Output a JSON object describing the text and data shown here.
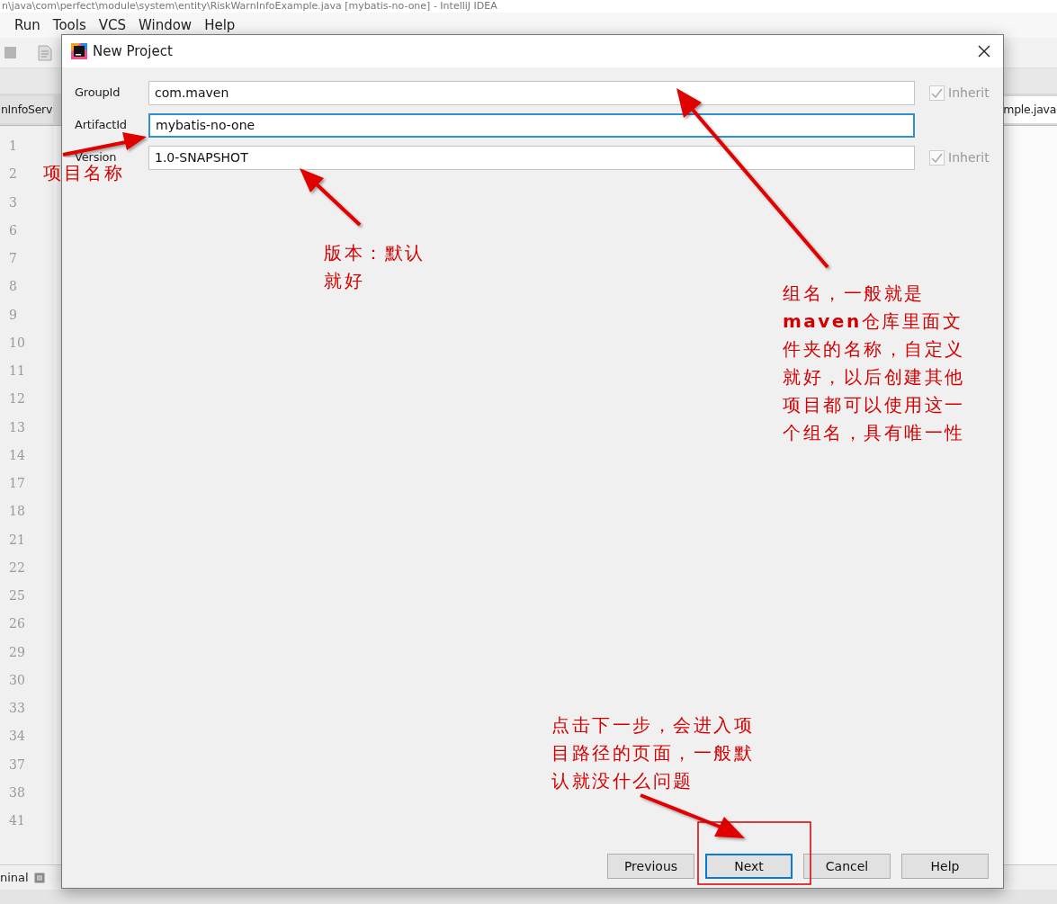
{
  "ide": {
    "title": "n\\java\\com\\perfect\\module\\system\\entity\\RiskWarnInfoExample.java [mybatis-no-one] - IntelliJ IDEA",
    "menu": [
      "Run",
      "Tools",
      "VCS",
      "Window",
      "Help"
    ],
    "tabs": [
      "nInfoServ",
      "mple.java"
    ],
    "line_numbers": [
      "1",
      "2",
      "3",
      "6",
      "7",
      "8",
      "9",
      "10",
      "11",
      "12",
      "13",
      "14",
      "17",
      "18",
      "21",
      "22",
      "25",
      "26",
      "29",
      "30",
      "33",
      "34",
      "37",
      "38",
      "41"
    ],
    "bottom_tab": "ninal"
  },
  "dialog": {
    "title": "New Project",
    "fields": [
      {
        "label": "GroupId",
        "value": "com.maven",
        "focused": false,
        "inherit": {
          "label": "Inherit",
          "checked": true
        }
      },
      {
        "label": "ArtifactId",
        "value": "mybatis-no-one",
        "focused": true
      },
      {
        "label": "Version",
        "value": "1.0-SNAPSHOT",
        "focused": false,
        "inherit": {
          "label": "Inherit",
          "checked": true
        }
      }
    ],
    "buttons": [
      {
        "label": "Previous",
        "default": false
      },
      {
        "label": "Next",
        "default": true
      },
      {
        "label": "Cancel",
        "default": false
      },
      {
        "label": "Help",
        "default": false
      }
    ]
  },
  "annotations": [
    "项目名称",
    "版本：默认就好",
    "组名，一般就是**maven**仓库里面文件夹的名称，自定义就好，以后创建其他项目都可以使用这一个组名，具有唯一性",
    "点击下一步，会进入项目路径的页面，一般默认就没什么问题"
  ]
}
